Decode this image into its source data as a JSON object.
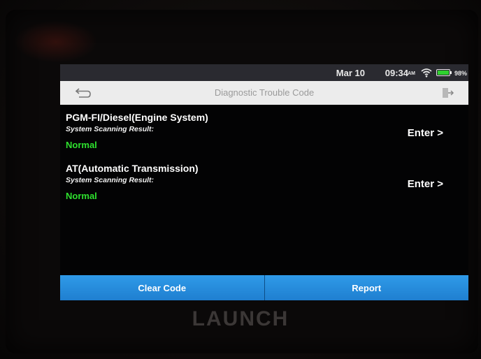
{
  "status_bar": {
    "date": "Mar 10",
    "time": "09:34",
    "ampm": "AM",
    "battery_pct": "98%",
    "battery_level": 0.98,
    "wifi_icon": "wifi-icon",
    "battery_icon": "battery-icon"
  },
  "title_bar": {
    "title": "Diagnostic Trouble Code",
    "back_icon": "back-arrow-icon",
    "exit_icon": "exit-icon"
  },
  "systems": [
    {
      "name": "PGM-FI/Diesel(Engine System)",
      "result_label": "System Scanning Result:",
      "result": "Normal",
      "enter_label": "Enter >"
    },
    {
      "name": "AT(Automatic Transmission)",
      "result_label": "System Scanning Result:",
      "result": "Normal",
      "enter_label": "Enter >"
    }
  ],
  "actions": {
    "clear_code": "Clear Code",
    "report": "Report"
  },
  "device": {
    "brand": "LAUNCH"
  },
  "colors": {
    "status_ok": "#2ee02e",
    "button_blue": "#2a8fe0",
    "title_bar_bg": "#ececec"
  }
}
